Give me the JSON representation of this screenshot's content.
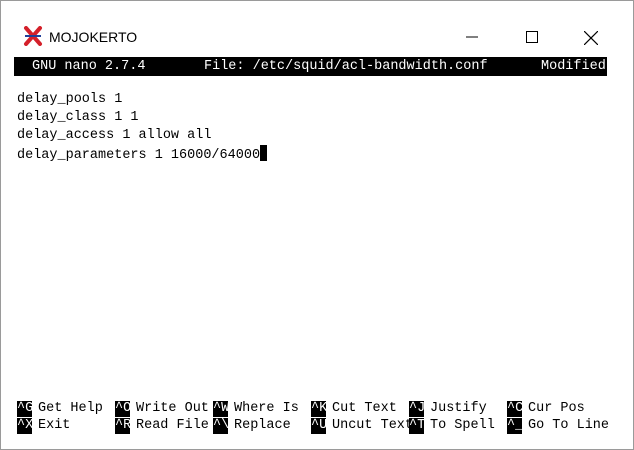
{
  "window": {
    "title": "MOJOKERTO"
  },
  "statusbar": {
    "version": "GNU nano 2.7.4",
    "file": "File: /etc/squid/acl-bandwidth.conf",
    "state": "Modified"
  },
  "editor": {
    "lines": [
      "delay_pools 1",
      "delay_class 1 1",
      "delay_access 1 allow all",
      "delay_parameters 1 16000/64000"
    ]
  },
  "shortcuts": {
    "row1": [
      {
        "key": "^G",
        "label": "Get Help"
      },
      {
        "key": "^O",
        "label": "Write Out"
      },
      {
        "key": "^W",
        "label": "Where Is"
      },
      {
        "key": "^K",
        "label": "Cut Text"
      },
      {
        "key": "^J",
        "label": "Justify"
      },
      {
        "key": "^C",
        "label": "Cur Pos"
      }
    ],
    "row2": [
      {
        "key": "^X",
        "label": "Exit"
      },
      {
        "key": "^R",
        "label": "Read File"
      },
      {
        "key": "^\\",
        "label": "Replace"
      },
      {
        "key": "^U",
        "label": "Uncut Text"
      },
      {
        "key": "^T",
        "label": "To Spell"
      },
      {
        "key": "^_",
        "label": "Go To Line"
      }
    ]
  },
  "colors": {
    "terminal_bg": "#ffffff",
    "terminal_fg": "#000000",
    "highlight_bg": "#000000",
    "highlight_fg": "#ffffff",
    "app_icon": "#d4202a"
  }
}
